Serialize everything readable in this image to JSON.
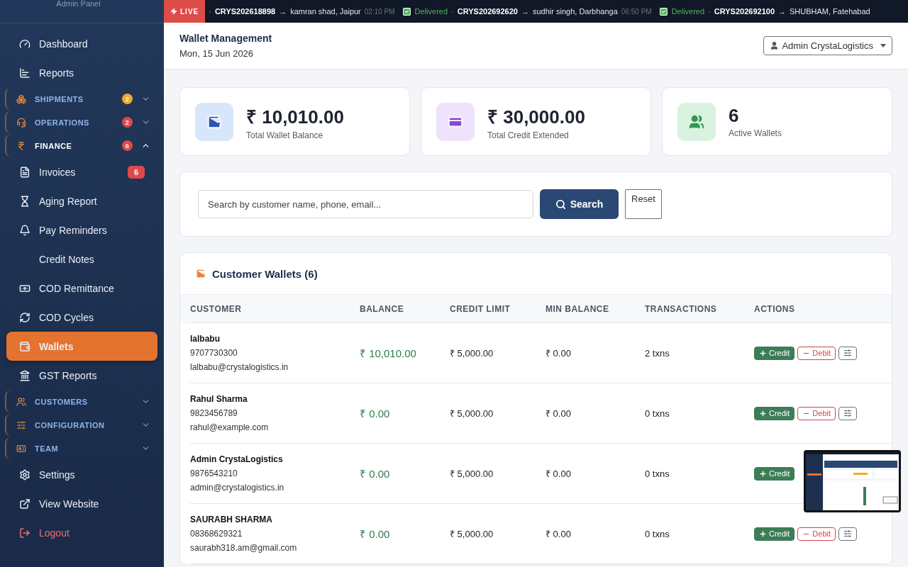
{
  "sidebar": {
    "brand_caption": "Admin Panel",
    "items": [
      {
        "kind": "link",
        "label": "Dashboard",
        "selected": false
      },
      {
        "kind": "link",
        "label": "Reports",
        "selected": false
      },
      {
        "kind": "section",
        "label": "SHIPMENTS",
        "badge": "2",
        "color": "#f0a929",
        "expanded": false
      },
      {
        "kind": "section",
        "label": "OPERATIONS",
        "badge": "2",
        "color": "#e0494a",
        "expanded": false
      },
      {
        "kind": "section",
        "label": "FINANCE",
        "badge": "6",
        "color": "#e0494a",
        "expanded": true,
        "children": [
          {
            "label": "Invoices",
            "badge": "6",
            "selected": false
          },
          {
            "label": "Aging Report",
            "selected": false
          },
          {
            "label": "Pay Reminders",
            "selected": false
          },
          {
            "label": "Credit Notes",
            "selected": false
          },
          {
            "label": "COD Remittance",
            "selected": false
          },
          {
            "label": "COD Cycles",
            "selected": false
          },
          {
            "label": "Wallets",
            "selected": true
          },
          {
            "label": "GST Reports",
            "selected": false
          }
        ]
      },
      {
        "kind": "section",
        "label": "CUSTOMERS",
        "expanded": false
      },
      {
        "kind": "section",
        "label": "CONFIGURATION",
        "expanded": false
      },
      {
        "kind": "section",
        "label": "TEAM",
        "expanded": false
      },
      {
        "kind": "link",
        "label": "Settings",
        "selected": false
      },
      {
        "kind": "link",
        "label": "View Website",
        "selected": false
      },
      {
        "kind": "logout",
        "label": "Logout",
        "selected": false
      }
    ]
  },
  "ticker": {
    "live_label": "LIVE",
    "items": [
      {
        "sep": "·",
        "id": "CRYS202618898",
        "arrow": "→",
        "dest": "kamran shad, Jaipur",
        "time": "02:10 PM"
      },
      {
        "status": "Delivered",
        "sep": "·",
        "id": "CRYS202692620",
        "arrow": "→",
        "dest": "sudhir singh, Darbhanga",
        "time": "06:50 PM"
      },
      {
        "status": "Delivered",
        "sep": "·",
        "id": "CRYS202692100",
        "arrow": "→",
        "dest": "SHUBHAM, Fatehabad"
      }
    ]
  },
  "header": {
    "title": "Wallet Management",
    "date": "Mon, 15 Jun 2026",
    "user": "Admin CrystaLogistics"
  },
  "stats": [
    {
      "value": "₹ 10,010.00",
      "label": "Total Wallet Balance"
    },
    {
      "value": "₹ 30,000.00",
      "label": "Total Credit Extended"
    },
    {
      "value": "6",
      "label": "Active Wallets"
    }
  ],
  "search": {
    "placeholder": "Search by customer name, phone, email...",
    "button": "Search",
    "reset": "Reset"
  },
  "table": {
    "title": "Customer Wallets (6)",
    "columns": [
      "CUSTOMER",
      "BALANCE",
      "CREDIT LIMIT",
      "MIN BALANCE",
      "TRANSACTIONS",
      "ACTIONS"
    ],
    "rows": [
      {
        "name": "lalbabu",
        "phone": "9707730300",
        "email": "lalbabu@crystalogistics.in",
        "balance": "₹ 10,010.00",
        "credit_limit": "₹ 5,000.00",
        "min_balance": "₹ 0.00",
        "transactions": "2 txns",
        "actions": [
          {
            "kind": "credit",
            "label": "Credit"
          },
          {
            "kind": "debit",
            "label": "Debit"
          },
          {
            "kind": "adjust"
          }
        ]
      },
      {
        "name": "Rahul Sharma",
        "phone": "9823456789",
        "email": "rahul@example.com",
        "balance": "₹ 0.00",
        "credit_limit": "₹ 5,000.00",
        "min_balance": "₹ 0.00",
        "transactions": "0 txns",
        "actions": [
          {
            "kind": "credit",
            "label": "Credit"
          },
          {
            "kind": "debit",
            "label": "Debit"
          },
          {
            "kind": "adjust"
          }
        ]
      },
      {
        "name": "Admin CrystaLogistics",
        "phone": "9876543210",
        "email": "admin@crystalogistics.in",
        "balance": "₹ 0.00",
        "credit_limit": "₹ 5,000.00",
        "min_balance": "₹ 0.00",
        "transactions": "0 txns",
        "actions": [
          {
            "kind": "credit",
            "label": "Credit"
          }
        ]
      },
      {
        "name": "SAURABH SHARMA",
        "phone": "08368629321",
        "email": "saurabh318.am@gmail.com",
        "balance": "₹ 0.00",
        "credit_limit": "₹ 5,000.00",
        "min_balance": "₹ 0.00",
        "transactions": "0 txns",
        "actions": [
          {
            "kind": "credit",
            "label": "Credit"
          },
          {
            "kind": "debit",
            "label": "Debit"
          },
          {
            "kind": "adjust"
          }
        ]
      }
    ]
  }
}
